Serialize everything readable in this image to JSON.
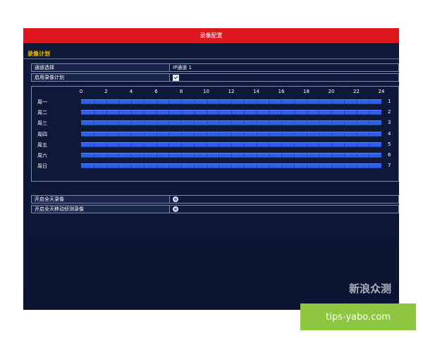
{
  "window": {
    "title": "录像配置"
  },
  "section": {
    "title": "录像计划"
  },
  "channel": {
    "label": "通道选择",
    "value": "IP通道 1"
  },
  "schedule_enable": {
    "label": "启用录像计划",
    "checked": true
  },
  "schedule": {
    "hours": [
      "0",
      "2",
      "4",
      "6",
      "8",
      "10",
      "12",
      "14",
      "16",
      "18",
      "20",
      "22",
      "24"
    ],
    "days": [
      {
        "label": "周一",
        "num": "1"
      },
      {
        "label": "周二",
        "num": "2"
      },
      {
        "label": "周三",
        "num": "3"
      },
      {
        "label": "周四",
        "num": "4"
      },
      {
        "label": "周五",
        "num": "5"
      },
      {
        "label": "周六",
        "num": "6"
      },
      {
        "label": "周日",
        "num": "7"
      }
    ],
    "bar_color": "#2f5fe8"
  },
  "options": {
    "all_day": {
      "label": "开启全天录像"
    },
    "all_day_motion": {
      "label": "开启全天移动侦测录像"
    }
  },
  "watermark": {
    "line1": "新浪众测",
    "url": "tips-yabo.com"
  },
  "colors": {
    "titlebar": "#e0161e",
    "accent": "#f2c200",
    "badge": "#8dc63f"
  }
}
